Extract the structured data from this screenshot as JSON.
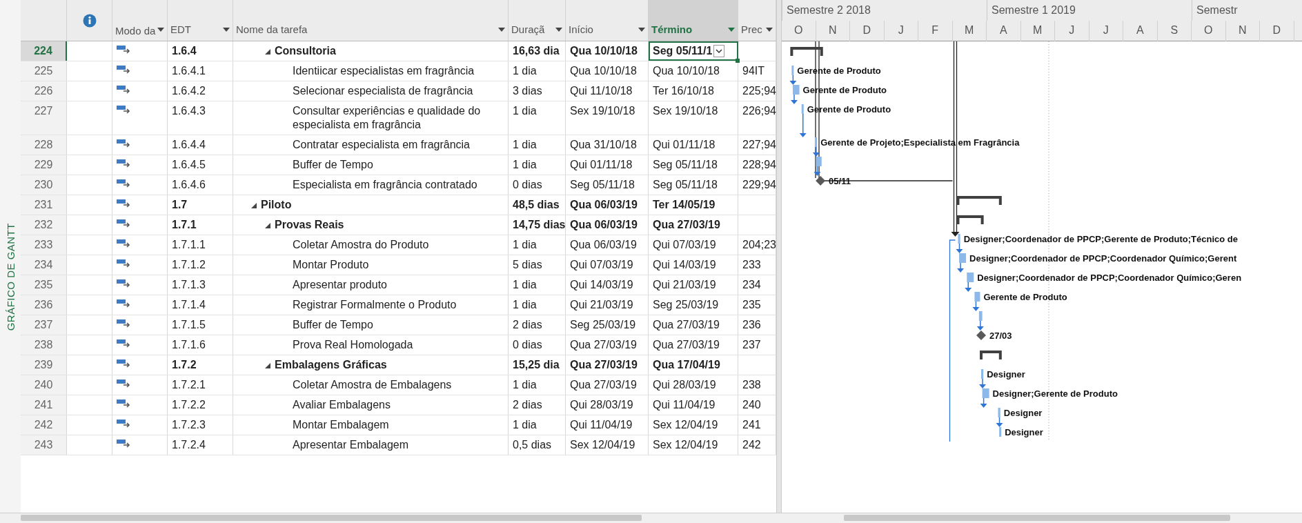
{
  "side_label": "GRÁFICO DE GANTT",
  "table": {
    "columns": [
      {
        "label": "Modo da",
        "selected": false
      },
      {
        "label": "EDT",
        "selected": false
      },
      {
        "label": "Nome da tarefa",
        "selected": false
      },
      {
        "label": "Duraçã",
        "selected": false
      },
      {
        "label": "Início",
        "selected": false
      },
      {
        "label": "Término",
        "selected": true
      },
      {
        "label": "Prec",
        "selected": false
      }
    ],
    "rows": [
      {
        "id": "224",
        "kind": "summary",
        "selected": true,
        "expanded": true,
        "edt": "1.6.4",
        "name": "Consultoria",
        "duration": "16,63 dia",
        "start": "Qua 10/10/18",
        "finish": "Seg 05/11/1",
        "children": [
          {
            "id": "225",
            "kind": "task",
            "selected": false,
            "edt": "1.6.4.1",
            "name": "Identiicar especialistas em fragrância",
            "duration": "1 dia",
            "start": "Qua 10/10/18",
            "finish": "Qua 10/10/18",
            "predecessors": "94IT",
            "bar_label": "Gerente de Produto"
          },
          {
            "id": "226",
            "kind": "task",
            "selected": false,
            "edt": "1.6.4.2",
            "name": "Selecionar especialista de fragrância",
            "duration": "3 dias",
            "start": "Qui 11/10/18",
            "finish": "Ter 16/10/18",
            "predecessors": "225;94",
            "bar_label": "Gerente de Produto"
          },
          {
            "id": "227",
            "kind": "task",
            "selected": false,
            "edt": "1.6.4.3",
            "name": "Consultar experiências e qualidade do especialista em fragrância",
            "duration": "1 dia",
            "start": "Sex 19/10/18",
            "finish": "Sex 19/10/18",
            "predecessors": "226;94",
            "bar_label": "Gerente de Produto"
          },
          {
            "id": "228",
            "kind": "task",
            "selected": false,
            "edt": "1.6.4.4",
            "name": "Contratar especialista em fragrância",
            "duration": "1 dia",
            "start": "Qua 31/10/18",
            "finish": "Qui 01/11/18",
            "predecessors": "227;94",
            "bar_label": "Gerente de Projeto;Especialista em Fragrância"
          },
          {
            "id": "229",
            "kind": "task",
            "selected": false,
            "edt": "1.6.4.5",
            "name": "Buffer de Tempo",
            "duration": "1 dia",
            "start": "Qui 01/11/18",
            "finish": "Seg 05/11/18",
            "predecessors": "228;94"
          },
          {
            "id": "230",
            "kind": "milestone",
            "selected": false,
            "edt": "1.6.4.6",
            "name": "Especialista em fragrância contratado",
            "duration": "0 dias",
            "start": "Seg 05/11/18",
            "finish": "Seg 05/11/18",
            "predecessors": "229;94",
            "bar_label": "05/11"
          }
        ]
      },
      {
        "id": "231",
        "kind": "summary",
        "selected": false,
        "expanded": true,
        "edt": "1.7",
        "name": "Piloto",
        "duration": "48,5 dias",
        "start": "Qua 06/03/19",
        "finish": "Ter 14/05/19",
        "children": [
          {
            "id": "232",
            "kind": "summary",
            "selected": false,
            "expanded": true,
            "edt": "1.7.1",
            "name": "Provas Reais",
            "duration": "14,75 dias",
            "start": "Qua 06/03/19",
            "finish": "Qua 27/03/19",
            "children": [
              {
                "id": "233",
                "kind": "task",
                "selected": false,
                "edt": "1.7.1.1",
                "name": "Coletar Amostra do Produto",
                "duration": "1 dia",
                "start": "Qua 06/03/19",
                "finish": "Qui 07/03/19",
                "predecessors": "204;23",
                "bar_label": "Designer;Coordenador de PPCP;Gerente de Produto;Técnico de"
              },
              {
                "id": "234",
                "kind": "task",
                "selected": false,
                "edt": "1.7.1.2",
                "name": "Montar Produto",
                "duration": "5 dias",
                "start": "Qui 07/03/19",
                "finish": "Qui 14/03/19",
                "predecessors": "233",
                "bar_label": "Designer;Coordenador de PPCP;Coordenador Químico;Gerent"
              },
              {
                "id": "235",
                "kind": "task",
                "selected": false,
                "edt": "1.7.1.3",
                "name": "Apresentar produto",
                "duration": "1 dia",
                "start": "Qui 14/03/19",
                "finish": "Qui 21/03/19",
                "predecessors": "234",
                "bar_label": "Designer;Coordenador de PPCP;Coordenador Químico;Geren"
              },
              {
                "id": "236",
                "kind": "task",
                "selected": false,
                "edt": "1.7.1.4",
                "name": "Registrar Formalmente o Produto",
                "duration": "1 dia",
                "start": "Qui 21/03/19",
                "finish": "Seg 25/03/19",
                "predecessors": "235",
                "bar_label": "Gerente de Produto"
              },
              {
                "id": "237",
                "kind": "task",
                "selected": false,
                "edt": "1.7.1.5",
                "name": "Buffer de Tempo",
                "duration": "2 dias",
                "start": "Seg 25/03/19",
                "finish": "Qua 27/03/19",
                "predecessors": "236"
              },
              {
                "id": "238",
                "kind": "milestone",
                "selected": false,
                "edt": "1.7.1.6",
                "name": "Prova Real Homologada",
                "duration": "0 dias",
                "start": "Qua 27/03/19",
                "finish": "Qua 27/03/19",
                "predecessors": "237",
                "bar_label": "27/03"
              }
            ]
          },
          {
            "id": "239",
            "kind": "summary",
            "selected": false,
            "expanded": true,
            "edt": "1.7.2",
            "name": "Embalagens Gráficas",
            "duration": "15,25 dia",
            "start": "Qua 27/03/19",
            "finish": "Qua 17/04/19",
            "children": [
              {
                "id": "240",
                "kind": "task",
                "selected": false,
                "edt": "1.7.2.1",
                "name": "Coletar Amostra de Embalagens",
                "duration": "1 dia",
                "start": "Qua 27/03/19",
                "finish": "Qui 28/03/19",
                "predecessors": "238",
                "bar_label": "Designer"
              },
              {
                "id": "241",
                "kind": "task",
                "selected": false,
                "edt": "1.7.2.2",
                "name": "Avaliar Embalagens",
                "duration": "2 dias",
                "start": "Qui 28/03/19",
                "finish": "Qui 11/04/19",
                "predecessors": "240",
                "bar_label": "Designer;Gerente de Produto"
              },
              {
                "id": "242",
                "kind": "task",
                "selected": false,
                "edt": "1.7.2.3",
                "name": "Montar Embalagem",
                "duration": "1 dia",
                "start": "Qui 11/04/19",
                "finish": "Sex 12/04/19",
                "predecessors": "241",
                "bar_label": "Designer"
              },
              {
                "id": "243",
                "kind": "task",
                "selected": false,
                "edt": "1.7.2.4",
                "name": "Apresentar Embalagem",
                "duration": "0,5 dias",
                "start": "Sex 12/04/19",
                "finish": "Sex 12/04/19",
                "predecessors": "242",
                "bar_label": "Designer"
              }
            ]
          }
        ]
      }
    ]
  },
  "timeline": {
    "semesters": [
      "Semestre 2 2018",
      "Semestre 1 2019",
      "Semestr"
    ],
    "months": [
      "O",
      "N",
      "D",
      "J",
      "F",
      "M",
      "A",
      "M",
      "J",
      "J",
      "A",
      "S",
      "O",
      "N",
      "D"
    ]
  }
}
